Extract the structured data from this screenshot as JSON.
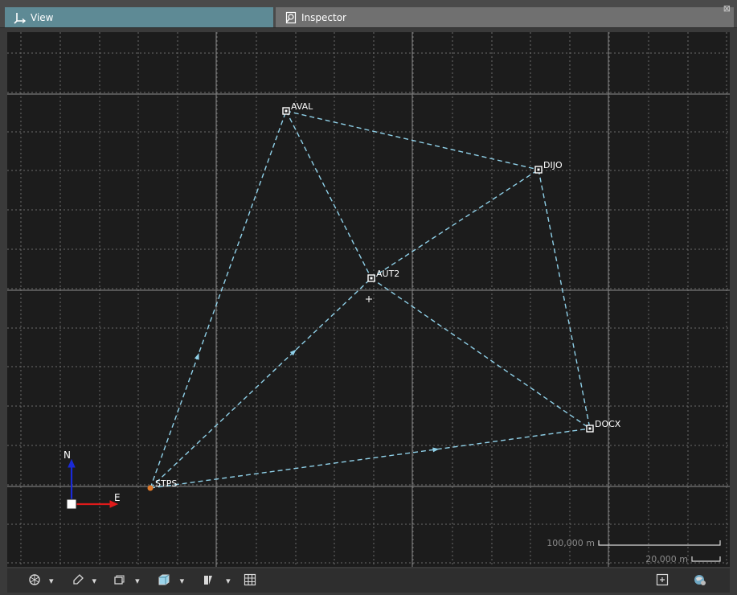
{
  "tabs": {
    "view_label": "View",
    "inspector_label": "Inspector",
    "close_symbol": "⊠"
  },
  "network": {
    "stations": [
      {
        "id": "AVAL",
        "label": "AVAL",
        "kind": "fixed"
      },
      {
        "id": "DIJO",
        "label": "DIJO",
        "kind": "fixed"
      },
      {
        "id": "AUT2",
        "label": "AUT2",
        "kind": "fixed"
      },
      {
        "id": "DOCX",
        "label": "DOCX",
        "kind": "fixed"
      },
      {
        "id": "STPS",
        "label": "STPS",
        "kind": "control"
      }
    ],
    "baselines": [
      {
        "from": "STPS",
        "to": "AVAL",
        "arrow": true
      },
      {
        "from": "STPS",
        "to": "AUT2",
        "arrow": true
      },
      {
        "from": "STPS",
        "to": "DOCX",
        "arrow": true
      },
      {
        "from": "AVAL",
        "to": "DIJO",
        "arrow": false
      },
      {
        "from": "AVAL",
        "to": "AUT2",
        "arrow": false
      },
      {
        "from": "AUT2",
        "to": "DIJO",
        "arrow": false
      },
      {
        "from": "AUT2",
        "to": "DOCX",
        "arrow": false
      },
      {
        "from": "DIJO",
        "to": "DOCX",
        "arrow": false
      }
    ],
    "baseline_color": "#8fd0e8",
    "control_color": "#e07a2a"
  },
  "axes": {
    "north_label": "N",
    "east_label": "E",
    "north_color": "#1a2ad8",
    "east_color": "#e01a1a"
  },
  "scale_bar": {
    "major_label": "100,000 m",
    "minor_label": "20,000 m"
  },
  "toolbar": {
    "items": [
      {
        "name": "display-mode-icon",
        "dropdown": true
      },
      {
        "name": "draw-tool-icon",
        "dropdown": true
      },
      {
        "name": "layers-icon",
        "dropdown": true
      },
      {
        "name": "cube-view-icon",
        "dropdown": true
      },
      {
        "name": "filter-icon",
        "dropdown": true
      },
      {
        "name": "grid-icon",
        "dropdown": false
      }
    ],
    "right_items": [
      {
        "name": "zoom-fit-icon"
      },
      {
        "name": "globe-settings-icon"
      }
    ]
  }
}
